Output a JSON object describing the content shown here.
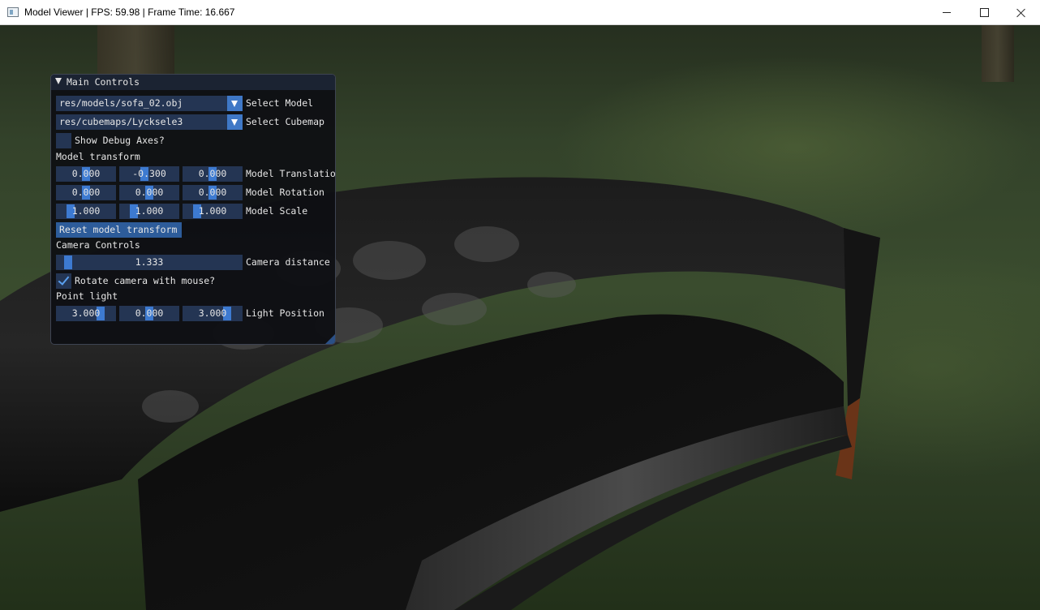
{
  "window": {
    "title": "Model Viewer | FPS: 59.98 | Frame Time: 16.667",
    "icons": {
      "app": "app-window-icon",
      "minimize": "minimize-icon",
      "maximize": "maximize-icon",
      "close": "close-icon"
    }
  },
  "panel": {
    "title": "Main Controls",
    "model_select": {
      "value": "res/models/sofa_02.obj",
      "label": "Select Model"
    },
    "cubemap_select": {
      "value": "res/cubemaps/Lycksele3",
      "label": "Select Cubemap"
    },
    "debug_axes": {
      "label": "Show Debug Axes?",
      "checked": false
    },
    "model_transform": {
      "header": "Model transform",
      "translation": {
        "values": [
          "0.000",
          "-0.300",
          "0.000"
        ],
        "label": "Model Translatio"
      },
      "rotation": {
        "values": [
          "0.000",
          "0.000",
          "0.000"
        ],
        "label": "Model Rotation"
      },
      "scale": {
        "values": [
          "1.000",
          "1.000",
          "1.000"
        ],
        "label": "Model Scale"
      },
      "reset_label": "Reset model transform"
    },
    "camera": {
      "header": "Camera Controls",
      "distance": {
        "value": "1.333",
        "label": "Camera distance"
      },
      "rotate_mouse": {
        "label": "Rotate camera with mouse?",
        "checked": true
      }
    },
    "light": {
      "header": "Point light",
      "position": {
        "values": [
          "3.000",
          "0.000",
          "3.000"
        ],
        "label": "Light Position"
      }
    }
  },
  "colors": {
    "widget_bg": "#243553",
    "accent": "#3d7ad1",
    "header_bg": "#1b2332",
    "panel_bg": "#0e0f13"
  }
}
